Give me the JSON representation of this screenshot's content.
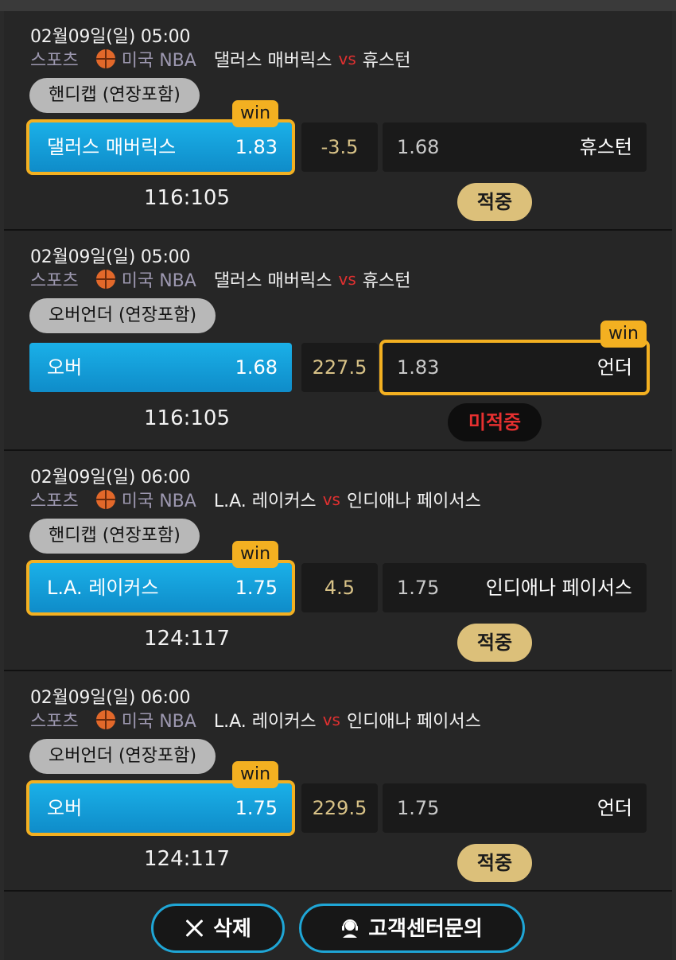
{
  "slips": [
    {
      "date": "02월09일(일) 05:00",
      "sport": "스포츠",
      "league": "미국 NBA",
      "home_team": "댈러스 매버릭스",
      "vs": "vs",
      "away_team": "휴스턴",
      "market": "핸디캡 (연장포함)",
      "selection_home": "댈러스 매버릭스",
      "odds_home": "1.83",
      "line": "-3.5",
      "odds_away": "1.68",
      "selection_away": "휴스턴",
      "win_tag": "win",
      "picked": "home",
      "score": "116:105",
      "result": "적중",
      "result_type": "hit"
    },
    {
      "date": "02월09일(일) 05:00",
      "sport": "스포츠",
      "league": "미국 NBA",
      "home_team": "댈러스 매버릭스",
      "vs": "vs",
      "away_team": "휴스턴",
      "market": "오버언더 (연장포함)",
      "selection_home": "오버",
      "odds_home": "1.68",
      "line": "227.5",
      "odds_away": "1.83",
      "selection_away": "언더",
      "win_tag": "win",
      "picked": "away",
      "score": "116:105",
      "result": "미적중",
      "result_type": "miss"
    },
    {
      "date": "02월09일(일) 06:00",
      "sport": "스포츠",
      "league": "미국 NBA",
      "home_team": "L.A. 레이커스",
      "vs": "vs",
      "away_team": "인디애나 페이서스",
      "market": "핸디캡 (연장포함)",
      "selection_home": "L.A. 레이커스",
      "odds_home": "1.75",
      "line": "4.5",
      "odds_away": "1.75",
      "selection_away": "인디애나 페이서스",
      "win_tag": "win",
      "picked": "home",
      "score": "124:117",
      "result": "적중",
      "result_type": "hit"
    },
    {
      "date": "02월09일(일) 06:00",
      "sport": "스포츠",
      "league": "미국 NBA",
      "home_team": "L.A. 레이커스",
      "vs": "vs",
      "away_team": "인디애나 페이서스",
      "market": "오버언더 (연장포함)",
      "selection_home": "오버",
      "odds_home": "1.75",
      "line": "229.5",
      "odds_away": "1.75",
      "selection_away": "언더",
      "win_tag": "win",
      "picked": "home",
      "score": "124:117",
      "result": "적중",
      "result_type": "hit"
    }
  ],
  "buttons": {
    "delete_label": "삭제",
    "support_label": "고객센터문의"
  },
  "icons": {
    "delete": "close-icon",
    "support": "customer-service-icon",
    "sport": "basketball-icon"
  },
  "colors": {
    "accent_blue": "#1ab0e8",
    "win_gold": "#f3b021",
    "hit_badge": "#dcc07a",
    "miss_text": "#e73030",
    "vs_red": "#e03030"
  }
}
